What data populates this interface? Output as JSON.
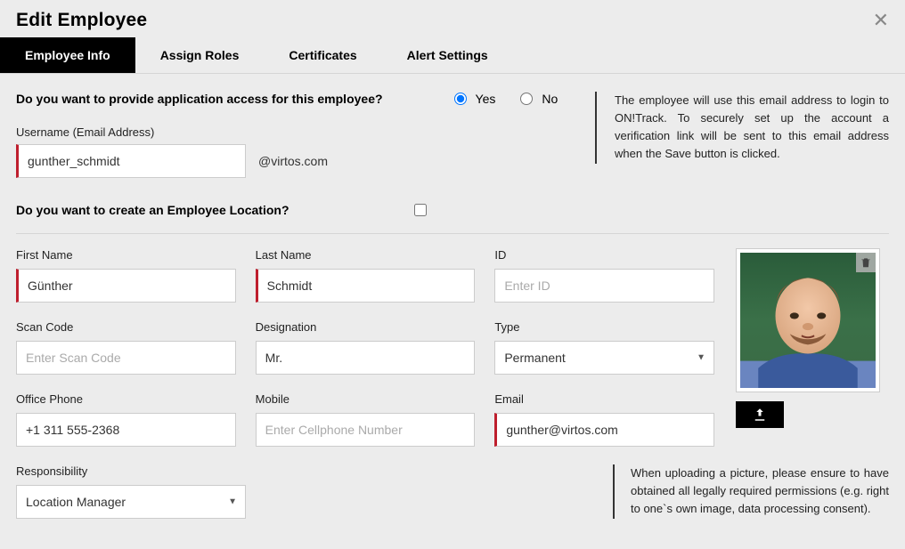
{
  "title": "Edit Employee",
  "tabs": [
    {
      "label": "Employee Info",
      "active": true
    },
    {
      "label": "Assign Roles",
      "active": false
    },
    {
      "label": "Certificates",
      "active": false
    },
    {
      "label": "Alert Settings",
      "active": false
    }
  ],
  "access_question": "Do you want to provide application access for this employee?",
  "access_yes": "Yes",
  "access_no": "No",
  "access_selected": "yes",
  "email_hint": "The employee will use this email address to login to ON!Track. To securely set up the account a verification link will be sent to this email address when the Save button is clicked.",
  "username_label": "Username (Email Address)",
  "username_value": "gunther_schmidt",
  "username_suffix": "@virtos.com",
  "location_question": "Do you want to create an Employee Location?",
  "location_checked": false,
  "fields": {
    "first_name": {
      "label": "First Name",
      "value": "Günther",
      "placeholder": ""
    },
    "last_name": {
      "label": "Last Name",
      "value": "Schmidt",
      "placeholder": ""
    },
    "id": {
      "label": "ID",
      "value": "",
      "placeholder": "Enter ID"
    },
    "scan_code": {
      "label": "Scan Code",
      "value": "",
      "placeholder": "Enter Scan Code"
    },
    "designation": {
      "label": "Designation",
      "value": "Mr.",
      "placeholder": ""
    },
    "type": {
      "label": "Type",
      "value": "Permanent"
    },
    "office_phone": {
      "label": "Office Phone",
      "value": "+1 311 555-2368",
      "placeholder": ""
    },
    "mobile": {
      "label": "Mobile",
      "value": "",
      "placeholder": "Enter Cellphone Number"
    },
    "email": {
      "label": "Email",
      "value": "gunther@virtos.com",
      "placeholder": ""
    },
    "responsibility": {
      "label": "Responsibility",
      "value": "Location Manager"
    }
  },
  "upload_hint": "When uploading a picture, please ensure to have obtained all legally required permissions (e.g. right to one`s own image, data processing consent)."
}
